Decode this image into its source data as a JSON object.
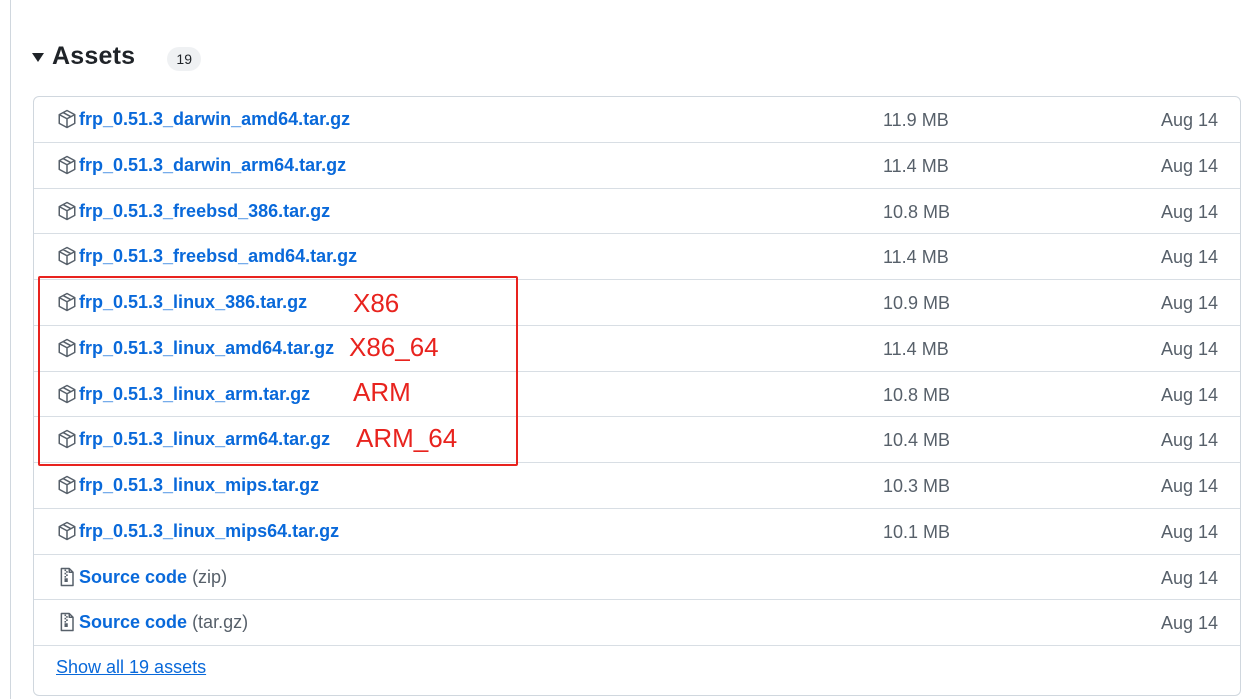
{
  "assets": {
    "title": "Assets",
    "count": "19",
    "show_all_label": "Show all 19 assets",
    "rows": [
      {
        "name": "frp_0.51.3_darwin_amd64.tar.gz",
        "suffix": "",
        "size": "11.9 MB",
        "date": "Aug 14",
        "icon": "package-icon"
      },
      {
        "name": "frp_0.51.3_darwin_arm64.tar.gz",
        "suffix": "",
        "size": "11.4 MB",
        "date": "Aug 14",
        "icon": "package-icon"
      },
      {
        "name": "frp_0.51.3_freebsd_386.tar.gz",
        "suffix": "",
        "size": "10.8 MB",
        "date": "Aug 14",
        "icon": "package-icon"
      },
      {
        "name": "frp_0.51.3_freebsd_amd64.tar.gz",
        "suffix": "",
        "size": "11.4 MB",
        "date": "Aug 14",
        "icon": "package-icon"
      },
      {
        "name": "frp_0.51.3_linux_386.tar.gz",
        "suffix": "",
        "size": "10.9 MB",
        "date": "Aug 14",
        "icon": "package-icon"
      },
      {
        "name": "frp_0.51.3_linux_amd64.tar.gz",
        "suffix": "",
        "size": "11.4 MB",
        "date": "Aug 14",
        "icon": "package-icon"
      },
      {
        "name": "frp_0.51.3_linux_arm.tar.gz",
        "suffix": "",
        "size": "10.8 MB",
        "date": "Aug 14",
        "icon": "package-icon"
      },
      {
        "name": "frp_0.51.3_linux_arm64.tar.gz",
        "suffix": "",
        "size": "10.4 MB",
        "date": "Aug 14",
        "icon": "package-icon"
      },
      {
        "name": "frp_0.51.3_linux_mips.tar.gz",
        "suffix": "",
        "size": "10.3 MB",
        "date": "Aug 14",
        "icon": "package-icon"
      },
      {
        "name": "frp_0.51.3_linux_mips64.tar.gz",
        "suffix": "",
        "size": "10.1 MB",
        "date": "Aug 14",
        "icon": "package-icon"
      },
      {
        "name": "Source code",
        "suffix": "(zip)",
        "size": "",
        "date": "Aug 14",
        "icon": "file-zip-icon"
      },
      {
        "name": "Source code",
        "suffix": "(tar.gz)",
        "size": "",
        "date": "Aug 14",
        "icon": "file-zip-icon"
      }
    ]
  },
  "annotations": {
    "color": "#e8231e",
    "labels": [
      "X86",
      "X86_64",
      "ARM",
      "ARM_64"
    ]
  },
  "colors": {
    "link": "#0969da",
    "muted": "#57606a",
    "border": "#d0d7de"
  }
}
